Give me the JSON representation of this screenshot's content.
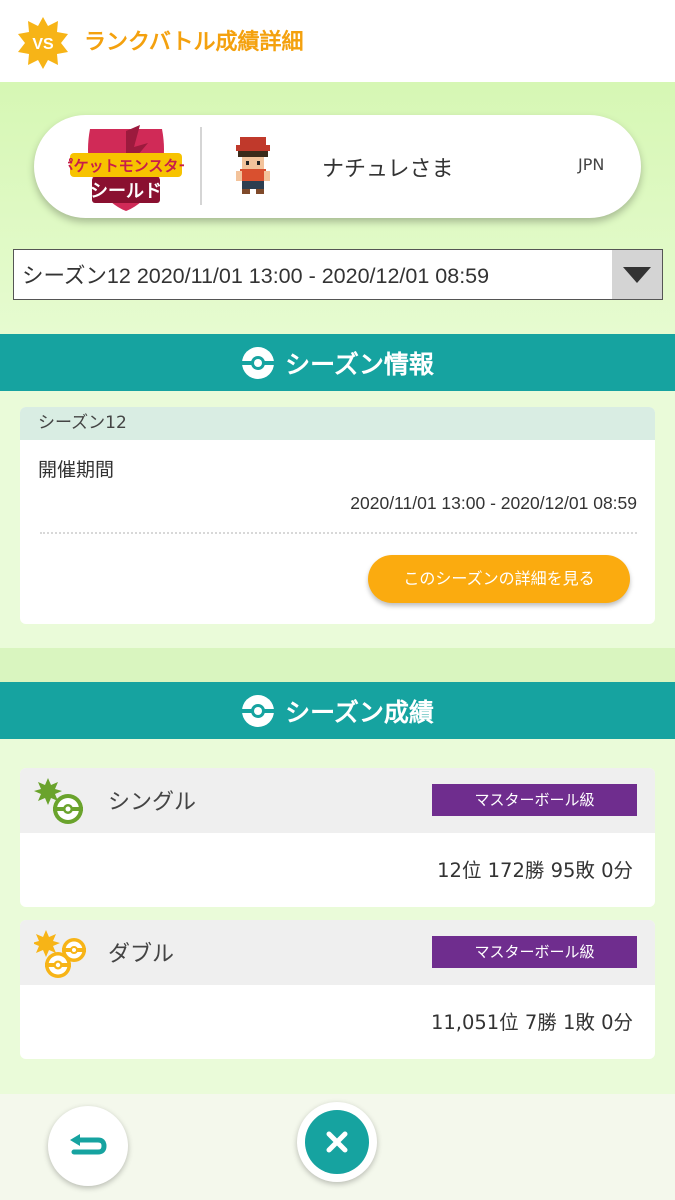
{
  "header": {
    "badge_text": "VS",
    "title": "ランクバトル成績詳細"
  },
  "profile": {
    "game_logo_line1": "ポケットモンスター",
    "game_logo_line2": "シールド",
    "player_name": "ナチュレさま",
    "region": "JPN"
  },
  "season_select": {
    "selected": "シーズン12 2020/11/01 13:00 - 2020/12/01 08:59"
  },
  "season_info": {
    "section_title": "シーズン情報",
    "season_name": "シーズン12",
    "period_label": "開催期間",
    "period_value": "2020/11/01 13:00 - 2020/12/01 08:59",
    "details_button": "このシーズンの詳細を見る"
  },
  "season_results": {
    "section_title": "シーズン成績",
    "items": [
      {
        "name": "シングル",
        "rank_class": "マスターボール級",
        "stats": "12位 172勝 95敗 0分"
      },
      {
        "name": "ダブル",
        "rank_class": "マスターボール級",
        "stats": "11,051位 7勝 1敗 0分"
      }
    ]
  },
  "colors": {
    "accent_orange": "#f4a10e",
    "teal": "#16a3a0",
    "master_ball_purple": "#6f2d8e",
    "button_orange": "#fbab0f"
  }
}
